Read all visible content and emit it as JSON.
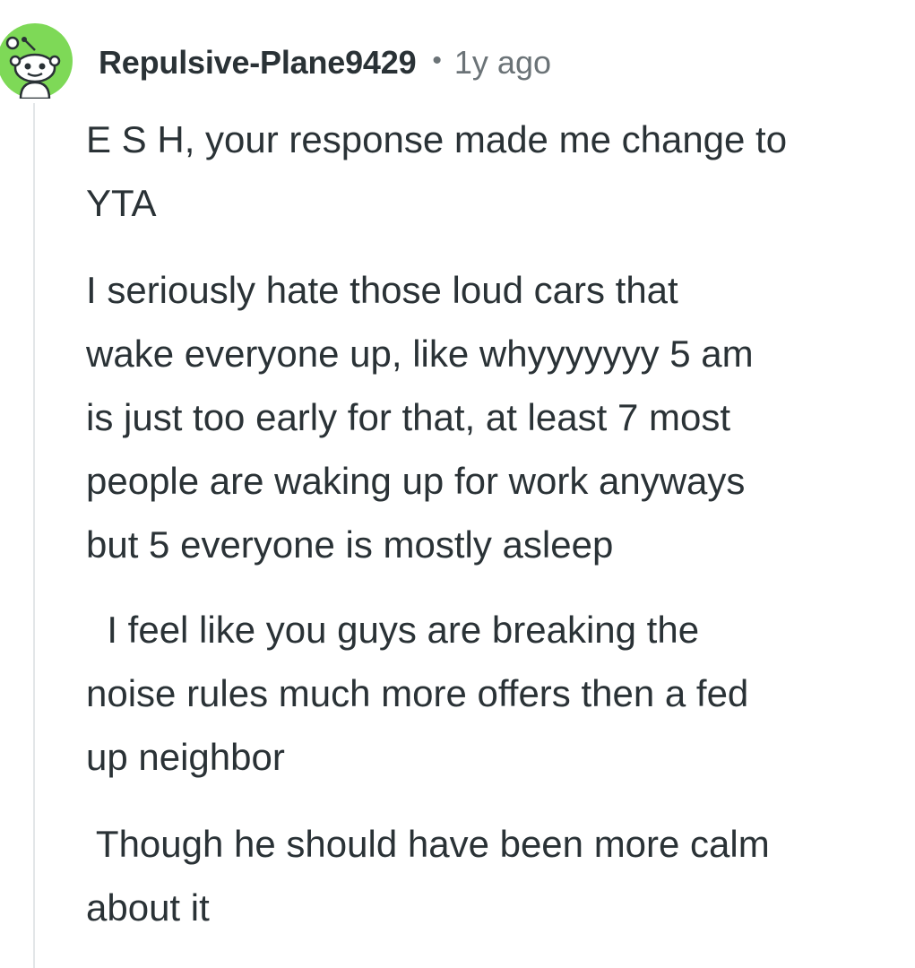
{
  "comment": {
    "username": "Repulsive-Plane9429",
    "separator": "•",
    "timestamp": "1y ago",
    "avatar_icon": "reddit-snoo-avatar-icon",
    "avatar_color": "#7ed957",
    "paragraphs": [
      {
        "lines": [
          "E S H, your response made me change to",
          "YTA"
        ]
      },
      {
        "lines": [
          "I seriously hate those loud cars that",
          "wake everyone up, like whyyyyyyy   5 am",
          "is just too early for that, at least 7 most",
          "people are waking up for work anyways",
          "but 5 everyone is mostly asleep"
        ]
      },
      {
        "lines": [
          "  I feel like you guys are breaking the",
          "noise rules much more offers then a fed",
          "up neighbor"
        ]
      },
      {
        "lines": [
          " Though he should have been more calm",
          "about it"
        ]
      }
    ]
  }
}
